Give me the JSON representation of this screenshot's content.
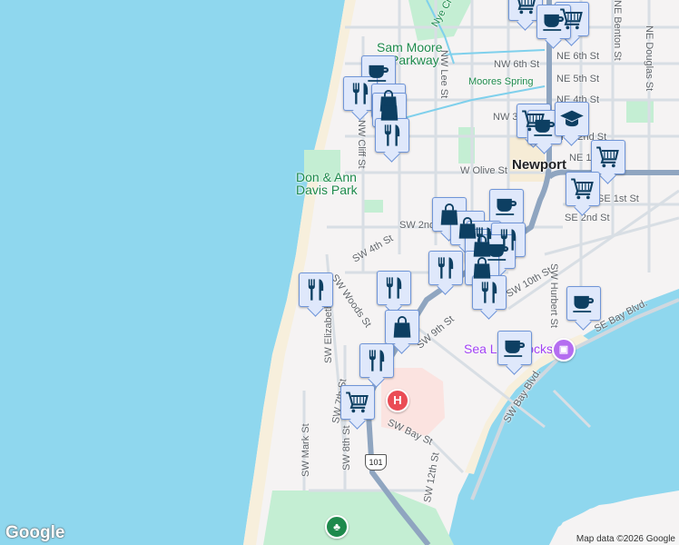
{
  "map": {
    "labels": {
      "sam_moore": "Sam Moore",
      "parkway": "Parkway",
      "nye_creek": "Nye Cr",
      "nw_lee": "NW Lee St",
      "nw_6th": "NW 6th St",
      "ne_6th": "NE 6th St",
      "ne_5th": "NE 5th St",
      "ne_4th": "NE 4th St",
      "moores_spring": "Moores Spring",
      "nw_3rd": "NW 3rd St",
      "ne_2nd": "NE 2nd St",
      "ne_1st": "NE 1st St",
      "nw_cliff": "NW Cliff St",
      "ne_benton": "NE Benton St",
      "ne_douglas": "NE Douglas St",
      "newport": "Newport",
      "w_olive": "W Olive St",
      "don_ann_1": "Don & Ann",
      "don_ann_2": "Davis Park",
      "se_1st": "SE 1st St",
      "se_2nd": "SE 2nd St",
      "sw_2nd": "SW 2nd St",
      "sw_4th": "SW 4th St",
      "sw_woods": "SW Woods St",
      "sw_elizabeth": "SW Elizabeth St",
      "sw_9th": "SW 9th St",
      "sw_10th": "SW 10th St",
      "sw_hurbert": "SW Hurbert St",
      "se_bay": "SE Bay Blvd.",
      "sw_bay_blvd": "SW Bay Blvd.",
      "sea_lion_docks": "Sea Lion Docks",
      "sw_bay_st": "SW Bay St",
      "sw_mark": "SW Mark St",
      "sw_8th": "SW 8th St",
      "sw_7th": "SW 7th St",
      "sw_12th": "SW 12th St",
      "hwy_101": "101"
    },
    "hospital_symbol": "H",
    "logo": "Google",
    "attribution": "Map data ©2026 Google",
    "colors": {
      "water": "#8fd7ee",
      "land": "#f5f3f3",
      "park": "#c4eed3",
      "highway": "#8fa5c0",
      "marker_fill": "#dfe8fb",
      "marker_icon": "#0d3f62"
    },
    "markers": [
      {
        "icon": "cart-icon"
      },
      {
        "icon": "cart-icon"
      },
      {
        "icon": "coffee-icon"
      },
      {
        "icon": "coffee-icon"
      },
      {
        "icon": "restaurant-icon"
      },
      {
        "icon": "shopping-bag-icon"
      },
      {
        "icon": "shopping-bag-icon"
      },
      {
        "icon": "restaurant-icon"
      },
      {
        "icon": "cart-icon"
      },
      {
        "icon": "coffee-icon"
      },
      {
        "icon": "graduation-cap-icon"
      },
      {
        "icon": "cart-icon"
      },
      {
        "icon": "cart-icon"
      },
      {
        "icon": "shopping-bag-icon"
      },
      {
        "icon": "coffee-icon"
      },
      {
        "icon": "shopping-bag-icon"
      },
      {
        "icon": "restaurant-icon"
      },
      {
        "icon": "shopping-bag-icon"
      },
      {
        "icon": "restaurant-icon"
      },
      {
        "icon": "coffee-icon"
      },
      {
        "icon": "restaurant-icon"
      },
      {
        "icon": "shopping-bag-icon"
      },
      {
        "icon": "restaurant-icon"
      },
      {
        "icon": "restaurant-icon"
      },
      {
        "icon": "restaurant-icon"
      },
      {
        "icon": "shopping-bag-icon"
      },
      {
        "icon": "coffee-icon"
      },
      {
        "icon": "coffee-icon"
      },
      {
        "icon": "restaurant-icon"
      },
      {
        "icon": "cart-icon"
      }
    ]
  }
}
